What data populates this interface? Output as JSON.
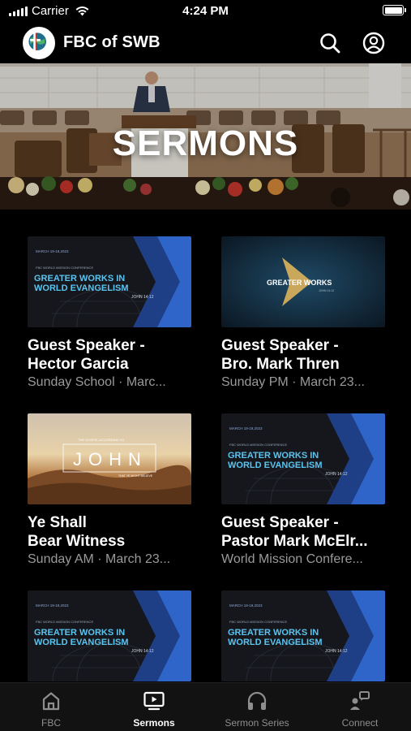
{
  "status_bar": {
    "carrier": "Carrier",
    "time": "4:24 PM"
  },
  "header": {
    "title": "FBC of SWB",
    "search_icon": "search-icon",
    "profile_icon": "profile-icon"
  },
  "hero": {
    "title": "SERMONS"
  },
  "thumb_text": {
    "conference_date": "MARCH 19-19,2023",
    "conference_name": "FBC WORLD MISSION CONFERENCE",
    "greater_works_line1": "GREATER WORKS IN",
    "greater_works_line2": "WORLD EVANGELISM",
    "john_ref": "JOHN 14:12",
    "greater_works_short": "GREATER WORKS",
    "gospel_label": "THE GOSPEL ACCORDING TO",
    "john_title": "JOHN",
    "john_sub": "THAT YE MIGHT BELIEVE"
  },
  "sermons": [
    {
      "title": "Guest Speaker -\nHector Garcia",
      "subtitle": "Sunday School · Marc...",
      "thumb": "conference"
    },
    {
      "title": "Guest Speaker -\nBro. Mark Thren",
      "subtitle": "Sunday PM · March 23...",
      "thumb": "greater-works"
    },
    {
      "title": "Ye Shall\nBear Witness",
      "subtitle": "Sunday AM · March 23...",
      "thumb": "john"
    },
    {
      "title": "Guest Speaker -\nPastor Mark McElr...",
      "subtitle": "World Mission Confere...",
      "thumb": "conference"
    },
    {
      "title": "",
      "subtitle": "",
      "thumb": "conference"
    },
    {
      "title": "",
      "subtitle": "",
      "thumb": "conference"
    }
  ],
  "tabs": [
    {
      "label": "FBC",
      "icon": "home-icon",
      "active": false
    },
    {
      "label": "Sermons",
      "icon": "tv-play-icon",
      "active": true
    },
    {
      "label": "Sermon Series",
      "icon": "headphones-icon",
      "active": false
    },
    {
      "label": "Connect",
      "icon": "connect-icon",
      "active": false
    }
  ],
  "colors": {
    "background": "#000000",
    "accent_blue": "#3d6fd6",
    "text_muted": "#9a9a9a",
    "tab_inactive": "#8e8e8e"
  }
}
